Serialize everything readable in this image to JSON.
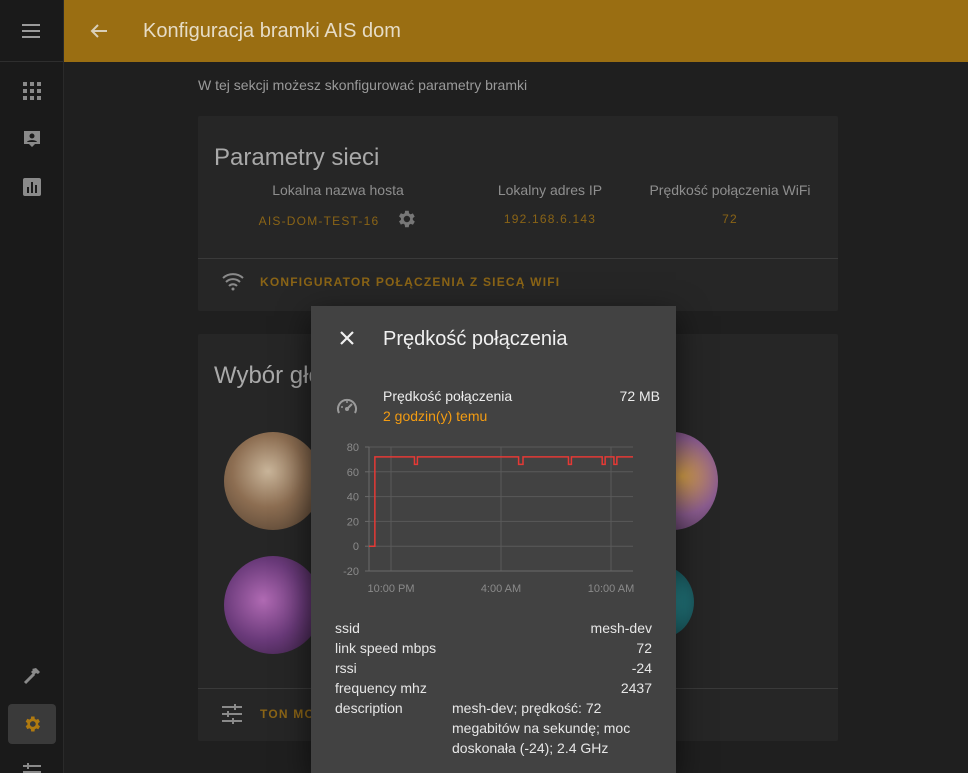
{
  "header": {
    "title": "Konfiguracja bramki AIS dom"
  },
  "intro": "W tej sekcji możesz skonfigurować parametry bramki",
  "network_card": {
    "title": "Parametry sieci",
    "hostname_label": "Lokalna nazwa hosta",
    "hostname_value": "AIS-DOM-TEST-16",
    "ip_label": "Lokalny adres IP",
    "ip_value": "192.168.6.143",
    "speed_label": "Prędkość połączenia WiFi",
    "speed_value": "72",
    "wifi_link": "KONFIGURATOR POŁĄCZENIA Z SIECĄ WIFI"
  },
  "voice_card": {
    "title": "Wybór gło",
    "tone_link": "TON MO"
  },
  "dialog": {
    "title": "Prędkość połączenia",
    "stat_name": "Prędkość połączenia",
    "stat_time": "2 godzin(y) temu",
    "stat_value": "72 MB",
    "attributes": [
      {
        "key": "ssid",
        "value": "mesh-dev"
      },
      {
        "key": "link speed mbps",
        "value": "72"
      },
      {
        "key": "rssi",
        "value": "-24"
      },
      {
        "key": "frequency mhz",
        "value": "2437"
      },
      {
        "key": "description",
        "value": "mesh-dev; prędkość: 72 megabitów na sekundę; moc doskonała (-24); 2.4 GHz"
      }
    ]
  },
  "chart_data": {
    "type": "line",
    "y_ticks": [
      "80",
      "60",
      "40",
      "20",
      "0",
      "-20"
    ],
    "ylim": [
      -20,
      80
    ],
    "x_ticks": [
      "10:00 PM",
      "4:00 AM",
      "10:00 AM"
    ],
    "series": [
      {
        "color": "#e53935",
        "x_hours": [
          0,
          0.4,
          3.0,
          3.1,
          3.3,
          10.1,
          10.2,
          10.5,
          13.5,
          13.6,
          13.8,
          15.8,
          15.9,
          16.1,
          16.6,
          16.7,
          16.9,
          18.0
        ],
        "values": [
          0,
          72,
          72,
          66,
          72,
          72,
          66,
          72,
          72,
          66,
          72,
          72,
          66,
          72,
          72,
          66,
          72,
          72
        ]
      }
    ],
    "grid": true
  },
  "colors": {
    "accent": "#f39c12",
    "header": "#9a6e12",
    "line": "#e53935"
  }
}
